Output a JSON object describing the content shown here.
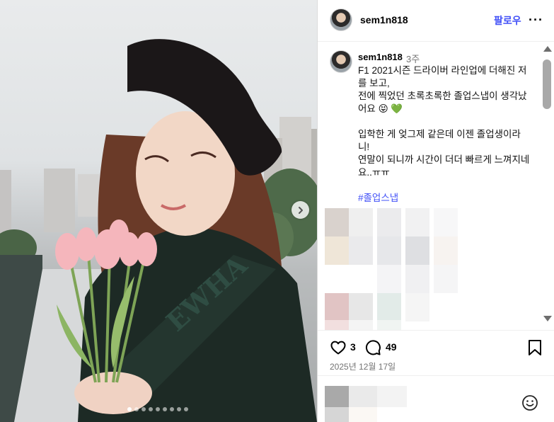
{
  "header": {
    "username": "sem1n818",
    "follow_label": "팔로우",
    "more_label": "···"
  },
  "caption": {
    "username": "sem1n818",
    "time": "3주",
    "text": "F1 2021시즌 드라이버 라인업에 더해진 저를 보고,\n전에 찍었던 초록초록한 졸업스냅이 생각났어요 😝 💚\n\n입학한 게 엊그제 같은데 이젠 졸업생이라니!\n연말이 되니까 시간이 더더 빠르게 느껴지네요..ㅠㅠ",
    "hashtag": "#졸업스냅"
  },
  "actions": {
    "like_count": "3",
    "comment_count": "49",
    "date": "2025년 12월 17일"
  },
  "carousel": {
    "total": 9,
    "active_index": 0
  },
  "icons": {
    "like": "heart-icon",
    "comment": "speech-bubble-icon",
    "save": "bookmark-icon",
    "emoji": "smiley-icon",
    "next": "chevron-right-icon",
    "more": "more-dots-icon"
  },
  "colors": {
    "accent": "#4150f7",
    "secondary_text": "#737373"
  }
}
